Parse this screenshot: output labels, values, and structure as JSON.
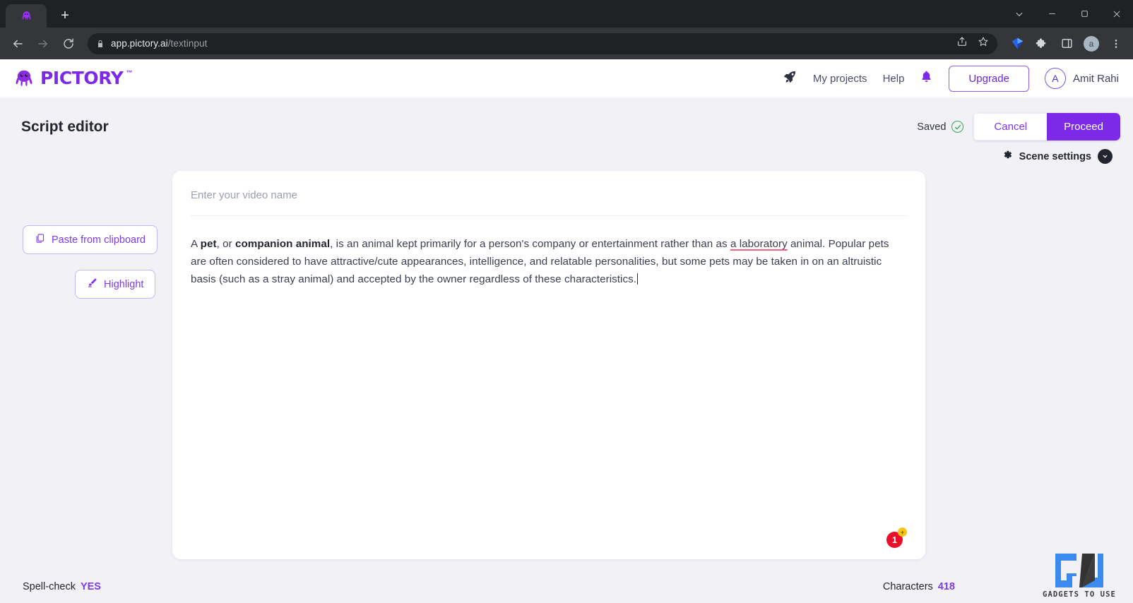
{
  "browser": {
    "tab_title": "",
    "url_host": "app.pictory.ai",
    "url_path": "/textinput",
    "new_tab_label": "+",
    "window": {
      "minimize": "—",
      "maximize": "❐",
      "close": "✕",
      "dropdown": "⌄"
    }
  },
  "app_header": {
    "logo_text": "PICTORY",
    "logo_tm": "™",
    "rocket_icon": "rocket-icon",
    "my_projects": "My projects",
    "help": "Help",
    "notifications_icon": "bell-icon",
    "upgrade": "Upgrade",
    "user_initial": "A",
    "user_name": "Amit Rahi"
  },
  "title_bar": {
    "title": "Script editor",
    "saved_label": "Saved",
    "saved_check": "✓",
    "cancel": "Cancel",
    "proceed": "Proceed"
  },
  "scene": {
    "label": "Scene settings",
    "chevron": "▼"
  },
  "tools": {
    "paste": "Paste from clipboard",
    "highlight": "Highlight"
  },
  "editor": {
    "video_name_value": "",
    "video_name_placeholder": "Enter your video name",
    "script": {
      "seg1": "A ",
      "bold1": "pet",
      "seg2": ", or ",
      "bold2": "companion animal",
      "seg3": ", is an animal kept primarily for a person's company or entertainment rather than as ",
      "misspelled": "a laboratory",
      "seg4": " animal. Popular pets are often considered to have attractive/cute appearances, intelligence, and relatable personalities, but some pets may be taken in on an altruistic basis (such as a stray animal) and accepted by the owner regardless of these characteristics."
    },
    "grammarly_count": "1",
    "grammarly_plus": "+"
  },
  "status": {
    "spellcheck_label": "Spell-check",
    "spellcheck_value": "YES",
    "characters_label": "Characters",
    "characters_value": "418"
  },
  "watermark": {
    "text": "GADGETS TO USE"
  },
  "colors": {
    "brand_purple": "#7c2ae8",
    "accent_purple": "#7c3aed",
    "saved_green": "#34a853",
    "badge_red": "#e8102a",
    "watermark_blue": "#3b8bef"
  }
}
